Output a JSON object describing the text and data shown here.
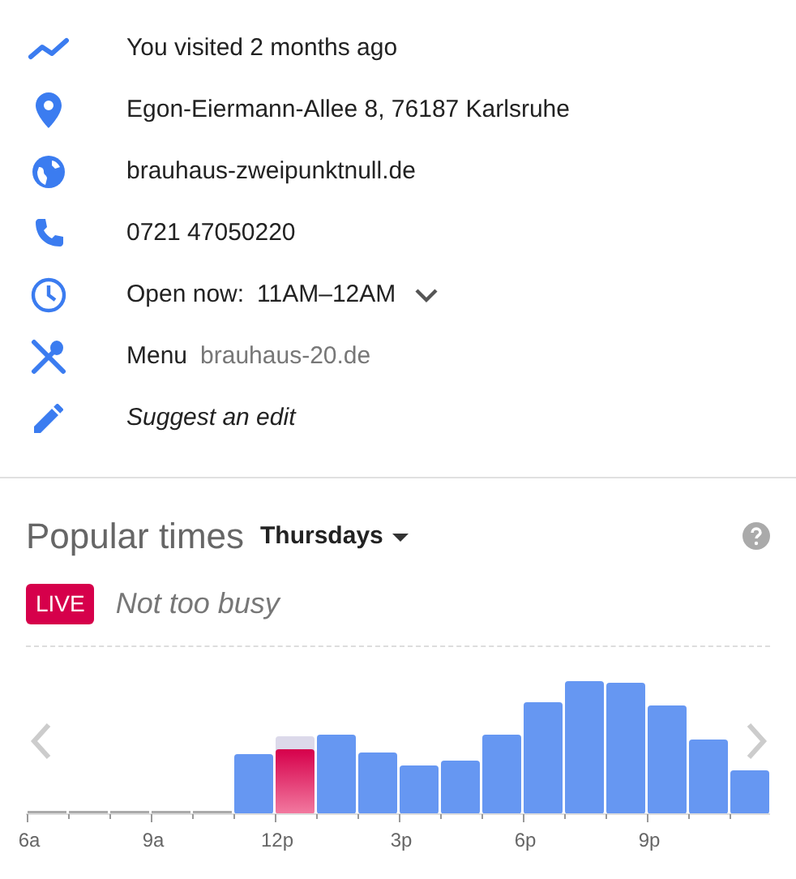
{
  "details": [
    {
      "kind": "visited",
      "text": "You visited 2 months ago"
    },
    {
      "kind": "address",
      "text": "Egon-Eiermann-Allee 8, 76187 Karlsruhe"
    },
    {
      "kind": "website",
      "text": "brauhaus-zweipunktnull.de"
    },
    {
      "kind": "phone",
      "text": "0721 47050220"
    },
    {
      "kind": "hours",
      "label": "Open now:",
      "value": "11AM–12AM"
    },
    {
      "kind": "menu",
      "label": "Menu",
      "value": "brauhaus-20.de"
    },
    {
      "kind": "edit",
      "text": "Suggest an edit"
    }
  ],
  "popular_times": {
    "title": "Popular times",
    "day": "Thursdays",
    "live_badge": "LIVE",
    "live_status": "Not too busy",
    "x_labels": [
      "6a",
      "9a",
      "12p",
      "3p",
      "6p",
      "9p"
    ]
  }
}
